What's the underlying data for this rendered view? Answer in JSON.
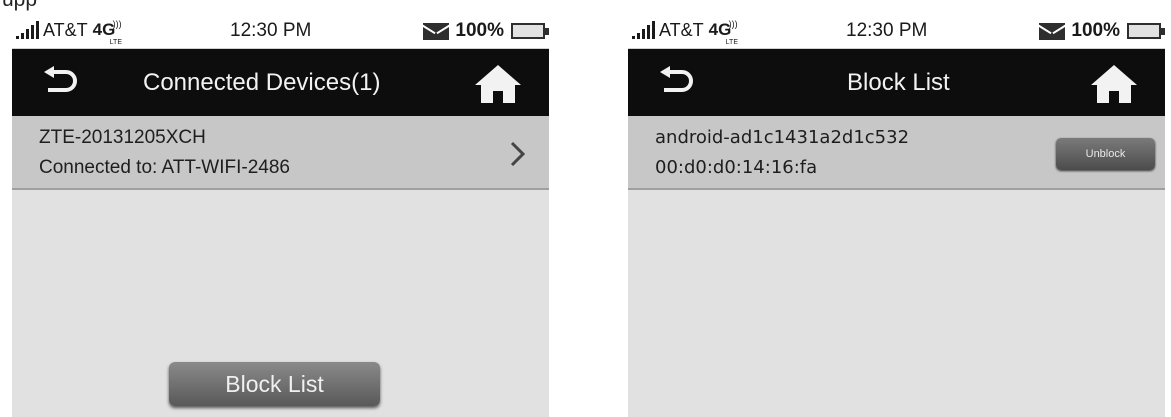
{
  "caption_fragment": "upp",
  "left_screen": {
    "status": {
      "carrier": "AT&T",
      "network": "4G",
      "network_sub": "LTE",
      "time": "12:30 PM",
      "battery": "100%"
    },
    "title": "Connected Devices(1)",
    "device": {
      "name": "ZTE-20131205XCH",
      "connection": "Connected to: ATT-WIFI-2486"
    },
    "block_list_button": "Block List"
  },
  "right_screen": {
    "status": {
      "carrier": "AT&T",
      "network": "4G",
      "network_sub": "LTE",
      "time": "12:30 PM",
      "battery": "100%"
    },
    "title": "Block List",
    "device": {
      "name": "android-ad1c1431a2d1c532",
      "mac": "00:d0:d0:14:16:fa"
    },
    "unblock_button": "Unblock"
  },
  "icons": [
    "signal-icon",
    "lte-icon",
    "mail-icon",
    "battery-icon",
    "back-icon",
    "home-icon",
    "chevron-right-icon"
  ],
  "colors": {
    "title_bar": "#0d0d0d",
    "list_row": "#c7c7c7",
    "screen_bg": "#e1e1e1",
    "button": "#6b6b6b"
  }
}
